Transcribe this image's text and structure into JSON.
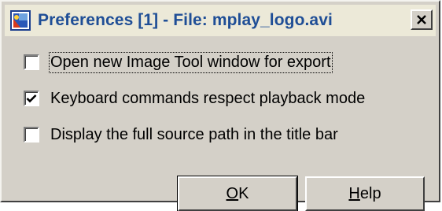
{
  "window": {
    "title": "Preferences [1] - File: mplay_logo.avi",
    "close_glyph": "✕",
    "app_icon": "mplay-app-icon"
  },
  "options": [
    {
      "label": "Open new Image Tool window for export",
      "checked": false,
      "focused": true
    },
    {
      "label": "Keyboard commands respect playback mode",
      "checked": true,
      "focused": false
    },
    {
      "label": "Display the full source path in the title bar",
      "checked": false,
      "focused": false
    }
  ],
  "buttons": {
    "ok_label": "OK",
    "help_label": "Help"
  },
  "colors": {
    "dialog_bg": "#d4d0c8",
    "titlebar_bg": "#ece9d8",
    "title_text": "#1f4e96"
  }
}
